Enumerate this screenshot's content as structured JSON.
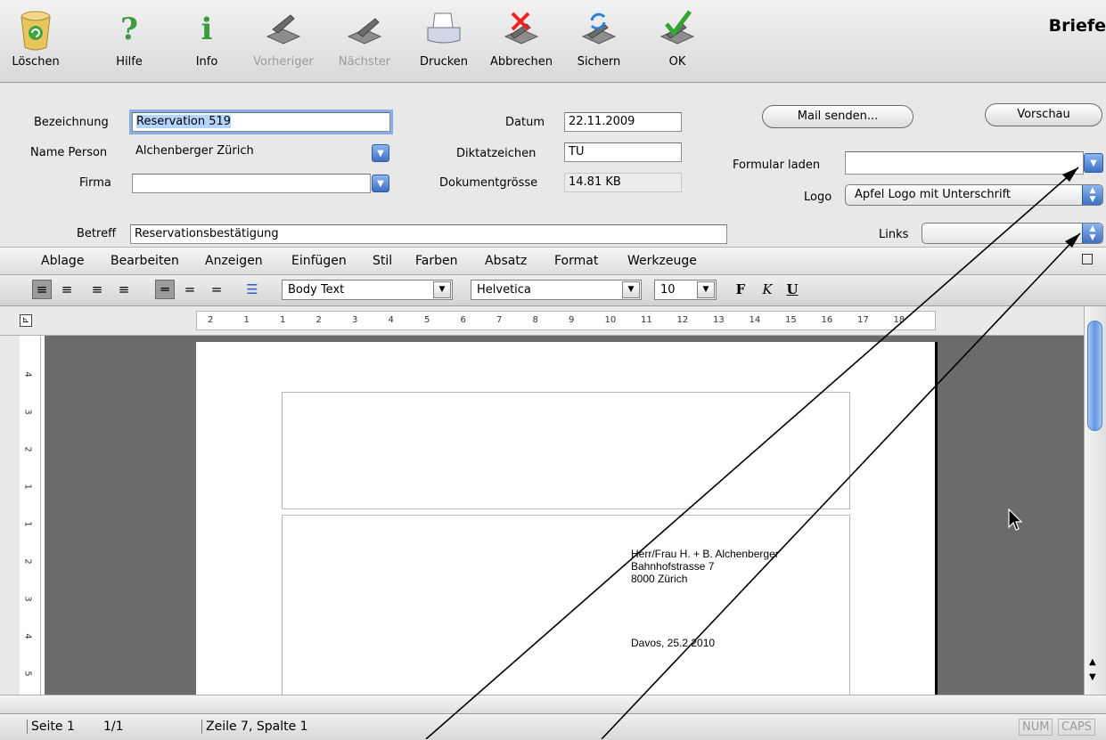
{
  "toolbar": {
    "title": "Briefe",
    "buttons": [
      {
        "label": "Löschen",
        "icon": "trash-icon"
      },
      {
        "label": "Hilfe",
        "icon": "question-icon"
      },
      {
        "label": "Info",
        "icon": "info-icon"
      },
      {
        "label": "Vorheriger",
        "icon": "previous-icon",
        "disabled": true
      },
      {
        "label": "Nächster",
        "icon": "next-icon",
        "disabled": true
      },
      {
        "label": "Drucken",
        "icon": "printer-icon"
      },
      {
        "label": "Abbrechen",
        "icon": "cancel-icon"
      },
      {
        "label": "Sichern",
        "icon": "save-icon"
      },
      {
        "label": "OK",
        "icon": "ok-check-icon"
      }
    ]
  },
  "form": {
    "bezeichnung_label": "Bezeichnung",
    "bezeichnung_value": "Reservation  519",
    "name_person_label": "Name Person",
    "name_person_value": "Alchenberger Zürich",
    "firma_label": "Firma",
    "firma_value": "",
    "betreff_label": "Betreff",
    "betreff_value": "Reservationsbestätigung",
    "datum_label": "Datum",
    "datum_value": "22.11.2009",
    "diktatzeichen_label": "Diktatzeichen",
    "diktatzeichen_value": "TU",
    "dokumentgroesse_label": "Dokumentgrösse",
    "dokumentgroesse_value": "14.81 KB",
    "mail_button": "Mail senden...",
    "vorschau_button": "Vorschau",
    "formular_laden_label": "Formular laden",
    "formular_laden_value": "",
    "logo_label": "Logo",
    "logo_value": "Apfel Logo mit Unterschrift",
    "links_label": "Links",
    "links_value": ""
  },
  "menubar": [
    "Ablage",
    "Bearbeiten",
    "Anzeigen",
    "Einfügen",
    "Stil",
    "Farben",
    "Absatz",
    "Format",
    "Werkzeuge"
  ],
  "formatbar": {
    "style": "Body Text",
    "font": "Helvetica",
    "size": "10",
    "bold": "F",
    "italic": "K",
    "underline": "U"
  },
  "ruler": {
    "h_ticks": [
      "2",
      "1",
      "1",
      "2",
      "3",
      "4",
      "5",
      "6",
      "7",
      "8",
      "9",
      "10",
      "11",
      "12",
      "13",
      "14",
      "15",
      "16",
      "17",
      "18"
    ],
    "v_ticks": [
      "4",
      "3",
      "2",
      "1",
      "1",
      "2",
      "3",
      "4",
      "5"
    ]
  },
  "document": {
    "address_lines": "Herr/Frau H. + B. Alchenberger\nBahnhofstrasse 7\n8000 Zürich",
    "date_line": "Davos, 25.2.2010"
  },
  "status": {
    "page": "Seite 1",
    "pages": "1/1",
    "position": "Zeile 7, Spalte 1",
    "num": "NUM",
    "caps": "CAPS"
  },
  "colors": {
    "accent_blue": "#3d6fc4",
    "focus_ring": "#86aee8",
    "doc_background": "#6b6b6b"
  }
}
